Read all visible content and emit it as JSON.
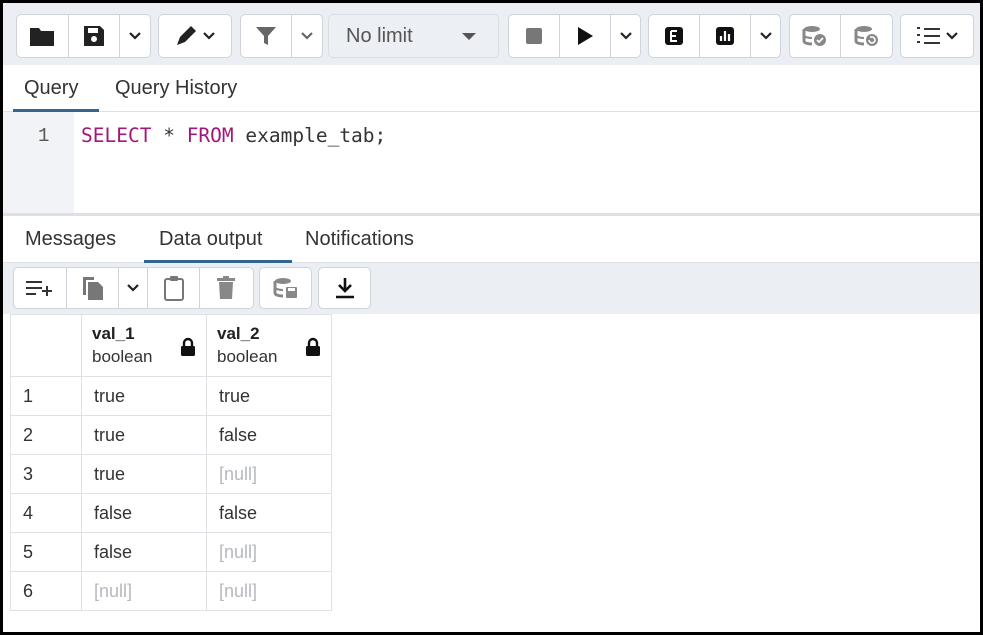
{
  "toolbar": {
    "buttons": [
      {
        "icon": "folder-icon"
      },
      {
        "icon": "save-icon"
      },
      {
        "icon": "chevron-down-icon"
      },
      {
        "icon": "edit-pen-icon"
      },
      {
        "icon": "filter-icon"
      },
      {
        "icon": "chevron-down-icon"
      },
      {
        "icon": "stop-icon"
      },
      {
        "icon": "play-icon"
      },
      {
        "icon": "chevron-down-icon"
      },
      {
        "icon": "explain-icon"
      },
      {
        "icon": "explain-analyze-icon"
      },
      {
        "icon": "chevron-down-icon"
      },
      {
        "icon": "commit-icon"
      },
      {
        "icon": "rollback-icon"
      },
      {
        "icon": "macros-list-icon"
      }
    ],
    "limit_value": "No limit"
  },
  "query_tabs": [
    "Query",
    "Query History"
  ],
  "editor": {
    "line_number": "1",
    "tokens": [
      "SELECT",
      " * ",
      "FROM",
      " example_tab;"
    ]
  },
  "output_tabs": [
    "Messages",
    "Data output",
    "Notifications"
  ],
  "output_toolbar": {
    "buttons": [
      {
        "icon": "add-row-icon"
      },
      {
        "icon": "copy-icon"
      },
      {
        "icon": "chevron-down-icon"
      },
      {
        "icon": "paste-icon"
      },
      {
        "icon": "delete-icon"
      },
      {
        "icon": "save-data-icon"
      },
      {
        "icon": "download-icon"
      }
    ]
  },
  "grid": {
    "columns": [
      {
        "name": "val_1",
        "type": "boolean"
      },
      {
        "name": "val_2",
        "type": "boolean"
      }
    ],
    "rows": [
      {
        "num": "1",
        "cells": [
          "true",
          "true"
        ]
      },
      {
        "num": "2",
        "cells": [
          "true",
          "false"
        ]
      },
      {
        "num": "3",
        "cells": [
          "true",
          "[null]"
        ]
      },
      {
        "num": "4",
        "cells": [
          "false",
          "false"
        ]
      },
      {
        "num": "5",
        "cells": [
          "false",
          "[null]"
        ]
      },
      {
        "num": "6",
        "cells": [
          "[null]",
          "[null]"
        ]
      }
    ]
  },
  "colors": {
    "accent": "#326690",
    "keyword": "#a21878",
    "null_text": "#b5b9be",
    "toolbar_bg": "#ebeef3"
  }
}
